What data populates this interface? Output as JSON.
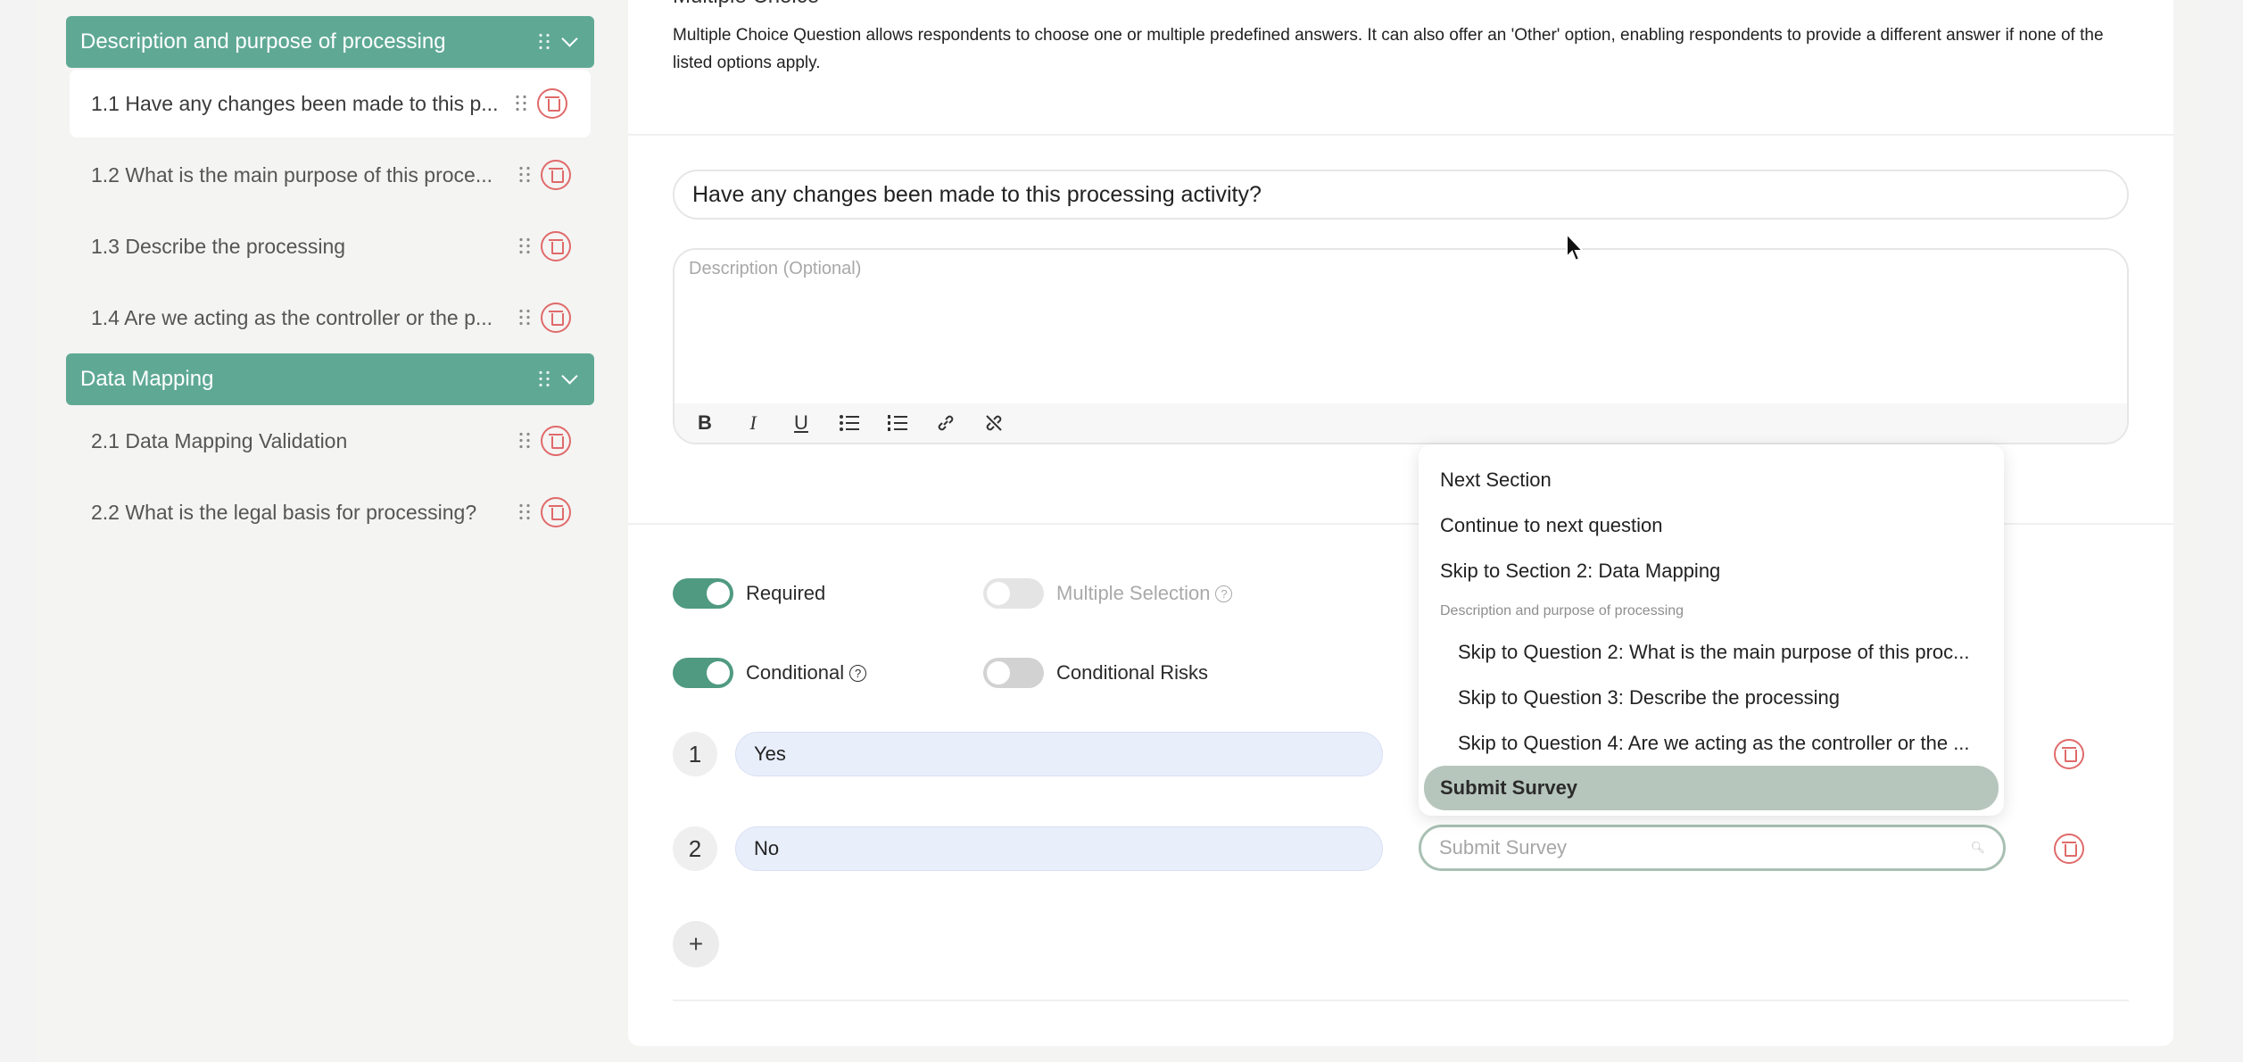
{
  "sidebar": {
    "sections": [
      {
        "title": "Description and purpose of processing",
        "items": [
          {
            "label": "1.1 Have any changes been made to this p..."
          },
          {
            "label": "1.2 What is the main purpose of this proce..."
          },
          {
            "label": "1.3 Describe the processing"
          },
          {
            "label": "1.4 Are we acting as the controller or the p..."
          }
        ]
      },
      {
        "title": "Data Mapping",
        "items": [
          {
            "label": "2.1 Data Mapping Validation"
          },
          {
            "label": "2.2 What is the legal basis for processing?"
          }
        ]
      }
    ]
  },
  "editor": {
    "type_title": "Multiple Choice",
    "type_description": "Multiple Choice Question allows respondents to choose one or multiple predefined answers. It can also offer an 'Other' option, enabling respondents to provide a different answer if none of the listed options apply.",
    "question_text": "Have any changes been made to this processing activity?",
    "description_placeholder": "Description (Optional)",
    "toolbar": {
      "bold": "B",
      "italic": "I",
      "underline": "U"
    }
  },
  "settings": {
    "required_label": "Required",
    "required_on": true,
    "multiple_selection_label": "Multiple Selection",
    "multiple_selection_on": false,
    "conditional_label": "Conditional",
    "conditional_on": true,
    "conditional_risks_label": "Conditional Risks",
    "conditional_risks_on": false
  },
  "options": [
    {
      "number": "1",
      "value": "Yes"
    },
    {
      "number": "2",
      "value": "No"
    }
  ],
  "action_select": {
    "placeholder": "Submit Survey"
  },
  "add_button": "+",
  "dropdown": {
    "items_top": [
      "Next Section",
      "Continue to next question",
      "Skip to Section 2: Data Mapping"
    ],
    "group_label": "Description and purpose of processing",
    "group_items": [
      "Skip to Question 2: What is the main purpose of this proc...",
      "Skip to Question 3: Describe the processing",
      "Skip to Question 4: Are we acting as the controller or the ..."
    ],
    "selected": "Submit Survey"
  },
  "colors": {
    "accent": "#5fa994",
    "toggle_on": "#4f9a80",
    "danger": "#e06a6a",
    "option_bg": "#e9eefb",
    "selected_bg": "#b7c6bd"
  }
}
